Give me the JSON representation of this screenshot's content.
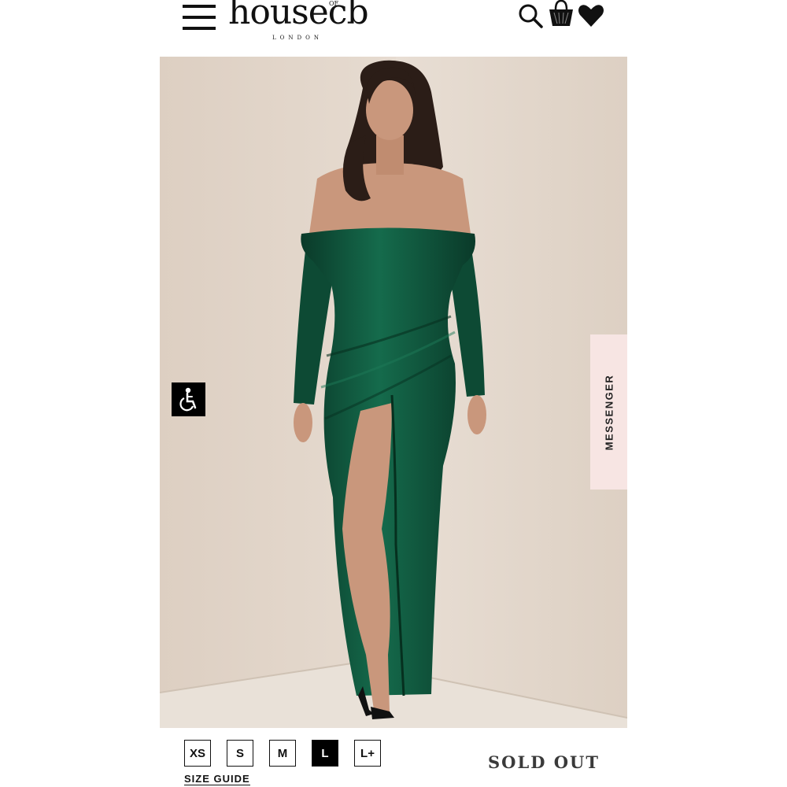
{
  "header": {
    "logo_text": "house",
    "logo_accent": "cb",
    "logo_of": "OF",
    "logo_sub": "LONDON",
    "icons": [
      "menu-icon",
      "search-icon",
      "shopping-bag-icon",
      "heart-icon"
    ]
  },
  "product_image": {
    "dress_color": "#0f4a35",
    "background_color": "#e2d5c9"
  },
  "accessibility_button": {
    "icon": "wheelchair-icon"
  },
  "messenger": {
    "label": "MESSENGER"
  },
  "sizes": {
    "options": [
      "XS",
      "S",
      "M",
      "L",
      "L+"
    ],
    "selected": "L"
  },
  "size_guide": {
    "label": "SIZE GUIDE"
  },
  "status": {
    "label": "SOLD OUT"
  }
}
